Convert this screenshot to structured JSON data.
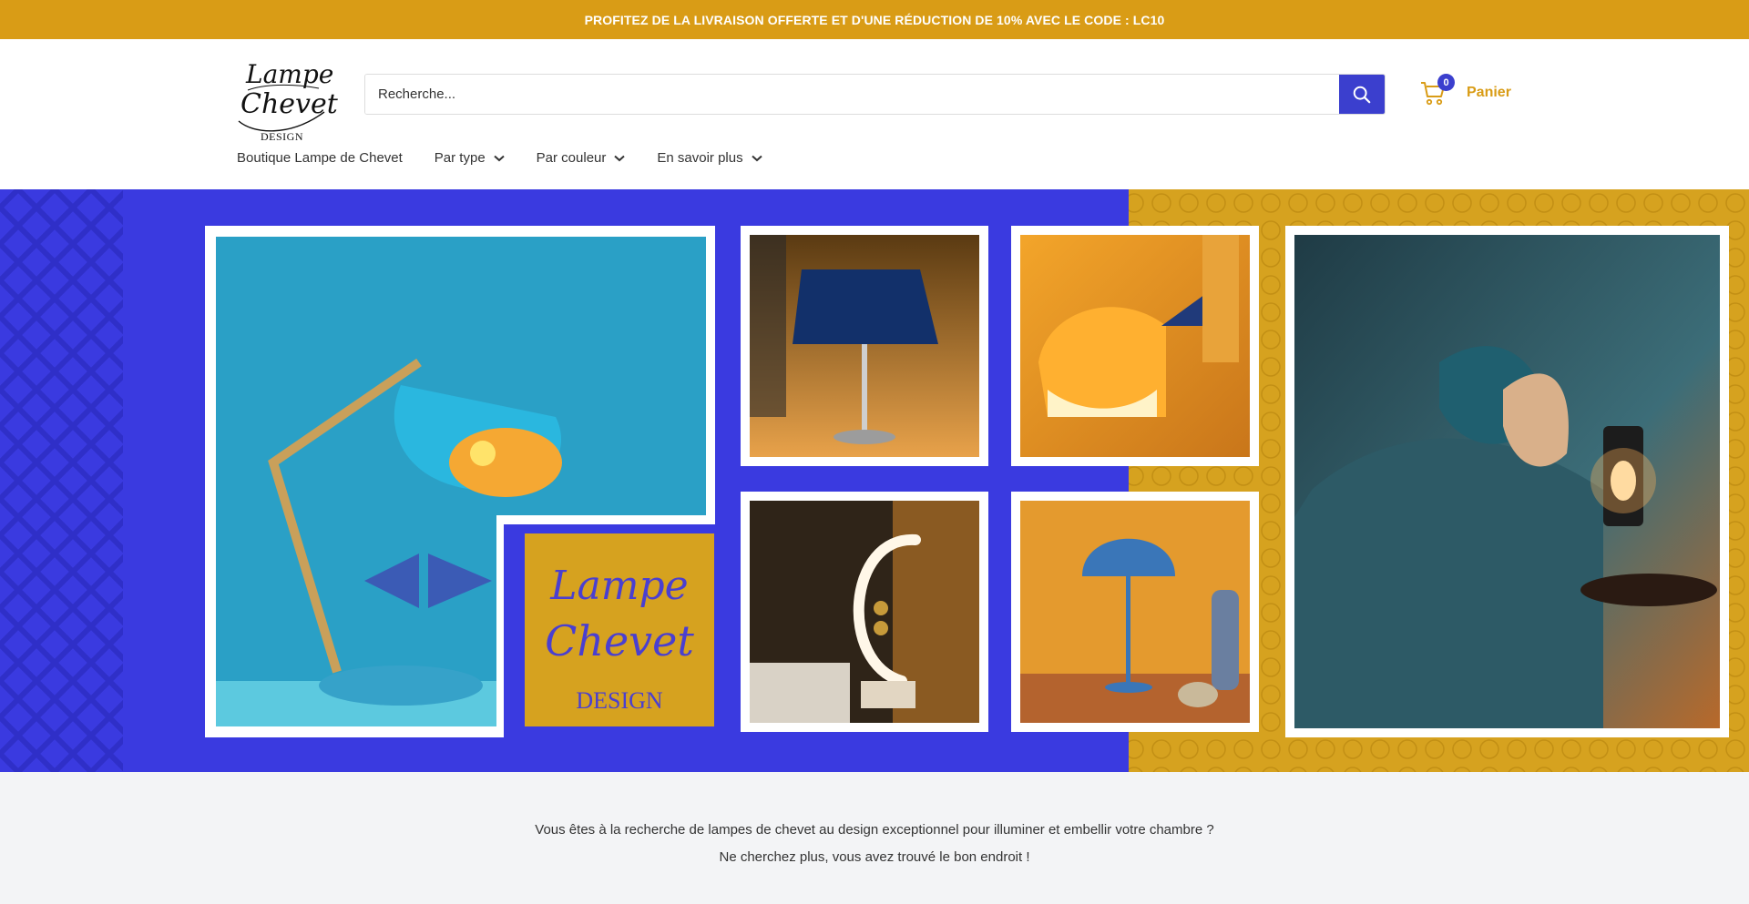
{
  "announcement": "PROFITEZ DE LA LIVRAISON OFFERTE ET D'UNE RÉDUCTION DE 10% AVEC LE CODE : LC10",
  "logo": {
    "line1": "Lampe",
    "line2": "Chevet",
    "line3": "DESIGN"
  },
  "search": {
    "placeholder": "Recherche..."
  },
  "cart": {
    "count": "0",
    "label": "Panier"
  },
  "nav": {
    "items": [
      {
        "label": "Boutique Lampe de Chevet",
        "has_dropdown": false
      },
      {
        "label": "Par type",
        "has_dropdown": true
      },
      {
        "label": "Par couleur",
        "has_dropdown": true
      },
      {
        "label": "En savoir plus",
        "has_dropdown": true
      }
    ]
  },
  "hero": {
    "banner_logo": {
      "line1": "Lampe",
      "line2": "Chevet",
      "line3": "DESIGN"
    }
  },
  "intro": {
    "line1": "Vous êtes à la recherche de lampes de chevet au design exceptionnel pour illuminer et embellir votre chambre ?",
    "line2": "Ne cherchez plus, vous avez trouvé le bon endroit !"
  },
  "colors": {
    "accent": "#d99c16",
    "brand_blue": "#3b3fce",
    "hero_blue": "#3a3ae0",
    "hero_gold": "#d6a21f"
  },
  "icons": {
    "search": "search-icon",
    "cart": "cart-icon",
    "chevron": "chevron-down-icon"
  }
}
